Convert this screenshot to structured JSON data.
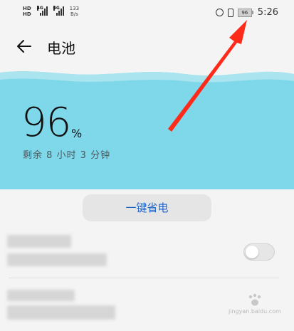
{
  "status_bar": {
    "sim1_label": "HD",
    "sim2_label": "HD",
    "net1": "4G",
    "net2": "4G",
    "speed_value": "133",
    "speed_unit": "B/s",
    "battery_icon_level": "96",
    "time": "5:26"
  },
  "header": {
    "title": "电池",
    "back_icon": "arrow-left-icon"
  },
  "battery": {
    "percent": "96",
    "percent_unit": "%",
    "remaining": "剩余 8 小时 3 分钟",
    "level_fraction": 0.96
  },
  "save_button": {
    "label": "一键省电"
  },
  "toggle": {
    "on": false
  },
  "watermark": {
    "text": "jingyan.baidu.com"
  },
  "colors": {
    "card": "#7fd8e9",
    "accent": "#1e63c8",
    "arrow": "#ff2a1a"
  }
}
